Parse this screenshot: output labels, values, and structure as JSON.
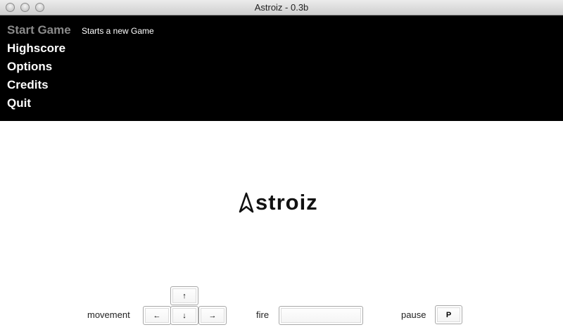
{
  "window": {
    "title": "Astroiz - 0.3b"
  },
  "menu": {
    "items": [
      {
        "label": "Start Game",
        "selected": true
      },
      {
        "label": "Highscore",
        "selected": false
      },
      {
        "label": "Options",
        "selected": false
      },
      {
        "label": "Credits",
        "selected": false
      },
      {
        "label": "Quit",
        "selected": false
      }
    ],
    "selected_description": "Starts a new Game",
    "selected_color": "#8a8a8a",
    "item_color": "#ffffff",
    "background": "#000000"
  },
  "logo": {
    "text": "stroiz",
    "mark_icon": "triangle-ship-icon"
  },
  "controls": {
    "movement_label": "movement",
    "fire_label": "fire",
    "pause_label": "pause",
    "keys": {
      "up": "↑",
      "left": "←",
      "down": "↓",
      "right": "→",
      "space": "",
      "pause": "P"
    }
  }
}
